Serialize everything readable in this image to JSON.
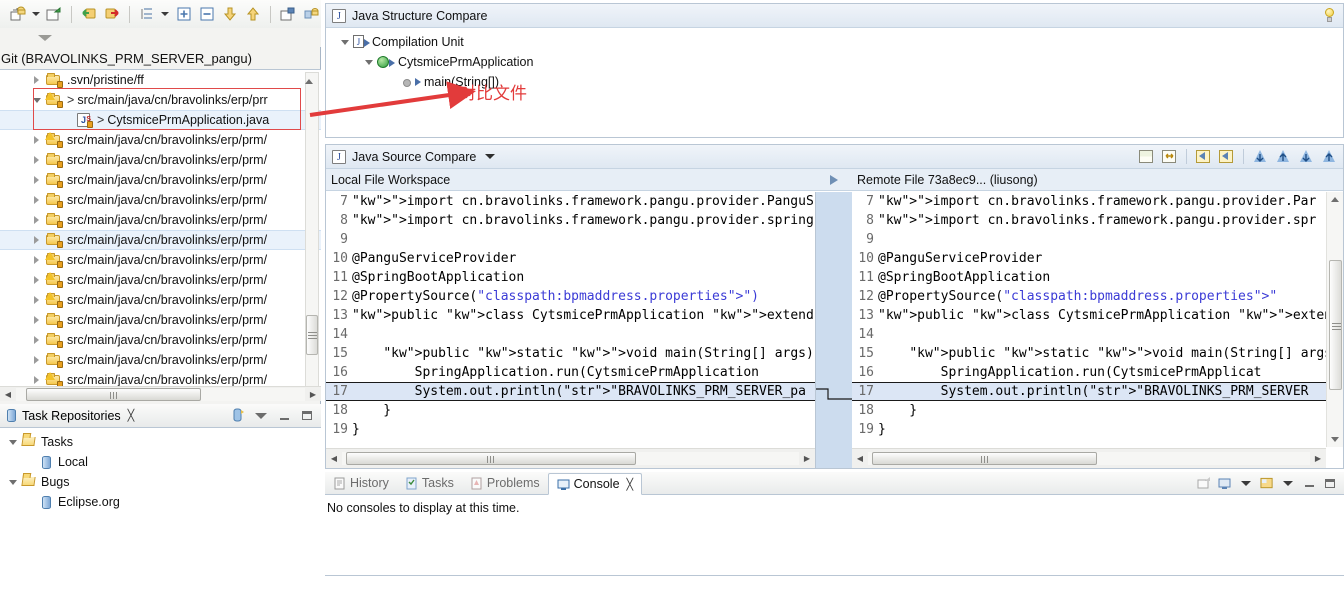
{
  "left_panel": {
    "toolbar_icons": [
      "new-repository-icon",
      "toolbar-dropdown-arrow",
      "clone-repository-icon",
      "pull-icon",
      "push-icon",
      "link-with-editor-icon",
      "view-menu-arrow",
      "expand-all-icon",
      "collapse-all-icon",
      "down-arrow-icon",
      "up-arrow-icon",
      "add-repository-icon",
      "copy-path-icon"
    ],
    "filter_arrow": "filter-dropdown-icon",
    "git_label": "Git (BRAVOLINKS_PRM_SERVER_pangu)",
    "tree": [
      {
        "label": ".svn/pristine/ff",
        "depth": 1,
        "expanded": false,
        "icon": "folder-icon",
        "selected": false,
        "warn": false,
        "prefix": ""
      },
      {
        "label": "src/main/java/cn/bravolinks/erp/prr",
        "depth": 1,
        "expanded": true,
        "icon": "folder-icon",
        "selected": false,
        "warn": true,
        "prefix": ">"
      },
      {
        "label": "CytsmicePrmApplication.java",
        "depth": 2,
        "expanded": false,
        "icon": "java-file-icon",
        "selected": true,
        "warn": false,
        "prefix": ">"
      },
      {
        "label": "src/main/java/cn/bravolinks/erp/prm/",
        "depth": 1,
        "expanded": false,
        "icon": "folder-icon",
        "selected": false,
        "warn": true,
        "prefix": ""
      },
      {
        "label": "src/main/java/cn/bravolinks/erp/prm/",
        "depth": 1,
        "expanded": false,
        "icon": "folder-icon",
        "selected": false,
        "warn": false,
        "prefix": ""
      },
      {
        "label": "src/main/java/cn/bravolinks/erp/prm/",
        "depth": 1,
        "expanded": false,
        "icon": "folder-icon",
        "selected": false,
        "warn": false,
        "prefix": ""
      },
      {
        "label": "src/main/java/cn/bravolinks/erp/prm/",
        "depth": 1,
        "expanded": false,
        "icon": "folder-icon",
        "selected": false,
        "warn": false,
        "prefix": ""
      },
      {
        "label": "src/main/java/cn/bravolinks/erp/prm/",
        "depth": 1,
        "expanded": false,
        "icon": "folder-icon",
        "selected": false,
        "warn": false,
        "prefix": ""
      },
      {
        "label": "src/main/java/cn/bravolinks/erp/prm/",
        "depth": 1,
        "expanded": false,
        "icon": "folder-icon",
        "selected": true,
        "warn": false,
        "prefix": ""
      },
      {
        "label": "src/main/java/cn/bravolinks/erp/prm/",
        "depth": 1,
        "expanded": false,
        "icon": "folder-icon",
        "selected": false,
        "warn": true,
        "prefix": ""
      },
      {
        "label": "src/main/java/cn/bravolinks/erp/prm/",
        "depth": 1,
        "expanded": false,
        "icon": "folder-icon",
        "selected": false,
        "warn": true,
        "prefix": ""
      },
      {
        "label": "src/main/java/cn/bravolinks/erp/prm/",
        "depth": 1,
        "expanded": false,
        "icon": "folder-icon",
        "selected": false,
        "warn": true,
        "prefix": ""
      },
      {
        "label": "src/main/java/cn/bravolinks/erp/prm/",
        "depth": 1,
        "expanded": false,
        "icon": "folder-icon",
        "selected": false,
        "warn": false,
        "prefix": ""
      },
      {
        "label": "src/main/java/cn/bravolinks/erp/prm/",
        "depth": 1,
        "expanded": false,
        "icon": "folder-icon",
        "selected": false,
        "warn": false,
        "prefix": ""
      },
      {
        "label": "src/main/java/cn/bravolinks/erp/prm/",
        "depth": 1,
        "expanded": false,
        "icon": "folder-icon",
        "selected": false,
        "warn": false,
        "prefix": ""
      },
      {
        "label": "src/main/java/cn/bravolinks/erp/prm/",
        "depth": 1,
        "expanded": false,
        "icon": "folder-icon",
        "selected": false,
        "warn": true,
        "prefix": ""
      }
    ]
  },
  "task_repositories": {
    "tab_label": "Task Repositories",
    "tab_icon": "task-repositories-icon",
    "close_glyph": "╳",
    "toolbar_icons": [
      "add-repository-icon",
      "view-menu-icon",
      "minimize-icon",
      "maximize-icon"
    ],
    "tree": [
      {
        "label": "Tasks",
        "depth": 1,
        "icon": "open-folder-icon",
        "expanded": true
      },
      {
        "label": "Local",
        "depth": 2,
        "icon": "repository-icon",
        "expanded": false
      },
      {
        "label": "Bugs",
        "depth": 1,
        "icon": "open-folder-icon",
        "expanded": true
      },
      {
        "label": "Eclipse.org",
        "depth": 2,
        "icon": "repository-icon",
        "expanded": false
      }
    ]
  },
  "structure_compare": {
    "title": "Java Structure Compare",
    "title_icon": "java-icon",
    "bulb_icon": "lightbulb-icon",
    "tree": [
      {
        "label": "Compilation Unit",
        "depth": 1,
        "icon": "compilation-unit-icon",
        "expanded": true
      },
      {
        "label": "CytsmicePrmApplication",
        "depth": 2,
        "icon": "class-icon",
        "expanded": true
      },
      {
        "label": "main(String[])",
        "depth": 3,
        "icon": "method-icon",
        "expanded": false
      }
    ]
  },
  "source_compare": {
    "title": "Java Source Compare",
    "title_icon": "java-icon",
    "menu_caret": "chevron-down-icon",
    "toolbar_icons": [
      "show-ancestor-pane-icon",
      "swap-sides-icon",
      "copy-right-to-left-icon",
      "copy-left-to-right-icon",
      "previous-difference-icon",
      "next-difference-icon",
      "previous-change-icon",
      "next-change-icon"
    ],
    "left_label": "Local File Workspace",
    "mid_icon": "diff-direction-icon",
    "right_label": "Remote File 73a8ec9... (liusong)",
    "left_lines": [
      {
        "no": "7",
        "text": "import cn.bravolinks.framework.pangu.provider.PanguS",
        "kw": "import",
        "diff": false
      },
      {
        "no": "8",
        "text": "import cn.bravolinks.framework.pangu.provider.spring",
        "kw": "import",
        "diff": false
      },
      {
        "no": "9",
        "text": "",
        "kw": "",
        "diff": false
      },
      {
        "no": "10",
        "text": "@PanguServiceProvider",
        "kw": "",
        "diff": false
      },
      {
        "no": "11",
        "text": "@SpringBootApplication",
        "kw": "",
        "diff": false
      },
      {
        "no": "12",
        "text": "@PropertySource(\"classpath:bpmaddress.properties\")",
        "kw": "",
        "diff": false
      },
      {
        "no": "13",
        "text": "public class CytsmicePrmApplication extends PanguPro",
        "kw": "",
        "diff": false
      },
      {
        "no": "14",
        "text": "",
        "kw": "",
        "diff": false
      },
      {
        "no": "15",
        "text": "    public static void main(String[] args) {",
        "kw": "",
        "diff": false
      },
      {
        "no": "16",
        "text": "        SpringApplication.run(CytsmicePrmApplication",
        "kw": "",
        "diff": false
      },
      {
        "no": "17",
        "text": "        System.out.println(\"BRAVOLINKS_PRM_SERVER_pa",
        "kw": "",
        "diff": true
      },
      {
        "no": "18",
        "text": "    }",
        "kw": "",
        "diff": false
      },
      {
        "no": "19",
        "text": "}",
        "kw": "",
        "diff": false
      }
    ],
    "right_lines": [
      {
        "no": "7",
        "text": "import cn.bravolinks.framework.pangu.provider.Par",
        "kw": "import",
        "diff": false
      },
      {
        "no": "8",
        "text": "import cn.bravolinks.framework.pangu.provider.spr",
        "kw": "import",
        "diff": false
      },
      {
        "no": "9",
        "text": "",
        "kw": "",
        "diff": false
      },
      {
        "no": "10",
        "text": "@PanguServiceProvider",
        "kw": "",
        "diff": false
      },
      {
        "no": "11",
        "text": "@SpringBootApplication",
        "kw": "",
        "diff": false
      },
      {
        "no": "12",
        "text": "@PropertySource(\"classpath:bpmaddress.properties\"",
        "kw": "",
        "diff": false
      },
      {
        "no": "13",
        "text": "public class CytsmicePrmApplication extends Pangu",
        "kw": "",
        "diff": false
      },
      {
        "no": "14",
        "text": "",
        "kw": "",
        "diff": false
      },
      {
        "no": "15",
        "text": "    public static void main(String[] args) {",
        "kw": "",
        "diff": false
      },
      {
        "no": "16",
        "text": "        SpringApplication.run(CytsmicePrmApplicat",
        "kw": "",
        "diff": false
      },
      {
        "no": "17",
        "text": "        System.out.println(\"BRAVOLINKS_PRM_SERVER",
        "kw": "",
        "diff": true
      },
      {
        "no": "18",
        "text": "    }",
        "kw": "",
        "diff": false
      },
      {
        "no": "19",
        "text": "}",
        "kw": "",
        "diff": false
      }
    ]
  },
  "console": {
    "tabs": [
      {
        "label": "History",
        "icon": "history-icon",
        "active": false
      },
      {
        "label": "Tasks",
        "icon": "tasks-icon",
        "active": false
      },
      {
        "label": "Problems",
        "icon": "problems-icon",
        "active": false
      },
      {
        "label": "Console",
        "icon": "console-icon",
        "active": true
      }
    ],
    "close_glyph": "╳",
    "message": "No consoles to display at this time.",
    "toolbar_icons": [
      "pin-console-icon",
      "display-selected-console-icon",
      "display-dropdown-icon",
      "open-console-icon",
      "open-console-dropdown-icon",
      "minimize-icon",
      "maximize-icon"
    ]
  },
  "annotation": {
    "text": "对比文件",
    "color": "#e23b3b"
  }
}
